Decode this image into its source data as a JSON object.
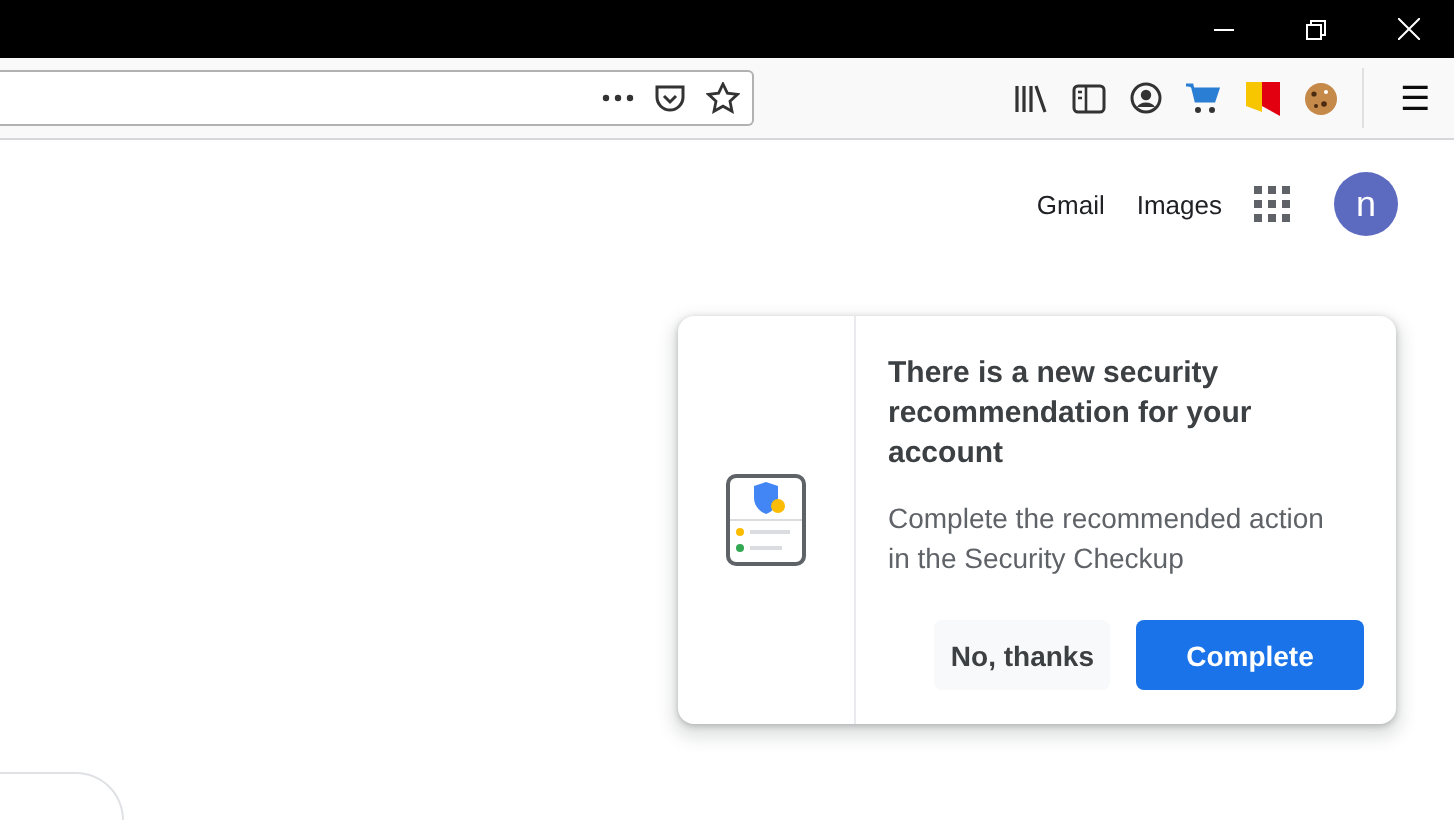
{
  "top_links": [
    "Gmail",
    "Images"
  ],
  "avatar": {
    "letter": "n"
  },
  "menu_icon": "☰",
  "card": {
    "title": "There is a new security recommendation for your account",
    "body": "Complete the recommended action in the Security Checkup",
    "buttons": [
      {
        "label": "No, thanks",
        "kind": "secondary"
      },
      {
        "label": "Complete",
        "kind": "primary"
      }
    ]
  }
}
